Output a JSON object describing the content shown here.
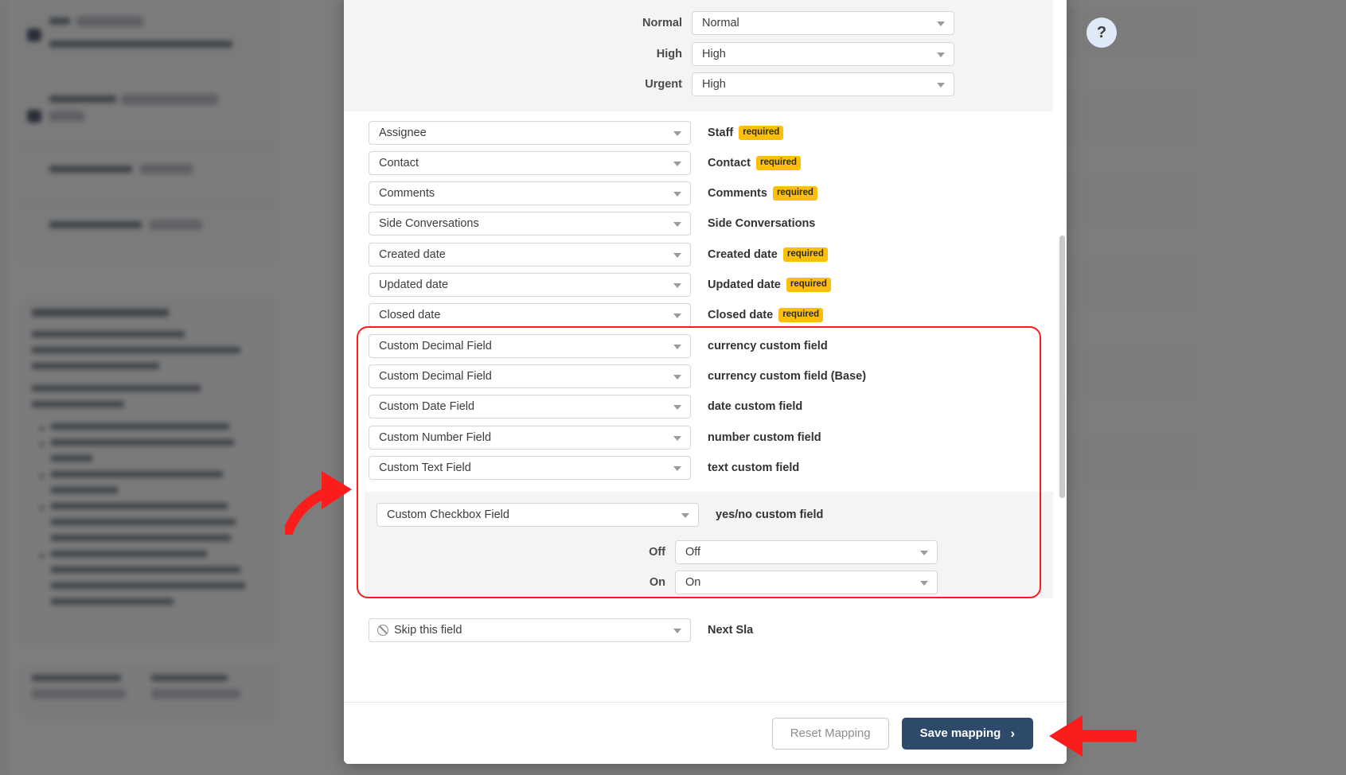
{
  "help": {
    "glyph": "?",
    "name": "help-button"
  },
  "modal": {
    "priority_panel": {
      "rows": [
        {
          "label": "Normal",
          "value": "Normal"
        },
        {
          "label": "High",
          "value": "High"
        },
        {
          "label": "Urgent",
          "value": "High"
        }
      ]
    },
    "mapping_rows": [
      {
        "source": "Assignee",
        "target": "Staff",
        "required": "required"
      },
      {
        "source": "Contact",
        "target": "Contact",
        "required": "required"
      },
      {
        "source": "Comments",
        "target": "Comments",
        "required": "required"
      },
      {
        "source": "Side Conversations",
        "target": "Side Conversations",
        "required": ""
      },
      {
        "source": "Created date",
        "target": "Created date",
        "required": "required"
      },
      {
        "source": "Updated date",
        "target": "Updated date",
        "required": "required"
      },
      {
        "source": "Closed date",
        "target": "Closed date",
        "required": "required"
      }
    ],
    "custom_rows": [
      {
        "source": "Custom Decimal Field",
        "target": "currency custom field"
      },
      {
        "source": "Custom Decimal Field",
        "target": "currency custom field (Base)"
      },
      {
        "source": "Custom Date Field",
        "target": "date custom field"
      },
      {
        "source": "Custom Number Field",
        "target": "number custom field"
      },
      {
        "source": "Custom Text Field",
        "target": "text custom field"
      }
    ],
    "checkbox_field": {
      "source": "Custom Checkbox Field",
      "target": "yes/no custom field",
      "values": [
        {
          "label": "Off",
          "value": "Off"
        },
        {
          "label": "On",
          "value": "On"
        }
      ]
    },
    "skip_row": {
      "source": "Skip this field",
      "target": "Next Sla"
    },
    "footer": {
      "reset_label": "Reset Mapping",
      "save_label": "Save mapping",
      "save_chevron": "›"
    }
  },
  "colors": {
    "accent_navy": "#2d4a6b",
    "badge_amber": "#fbbf0b",
    "annotation_red": "#fb1c1c",
    "panel_gray": "#f4f4f4"
  }
}
